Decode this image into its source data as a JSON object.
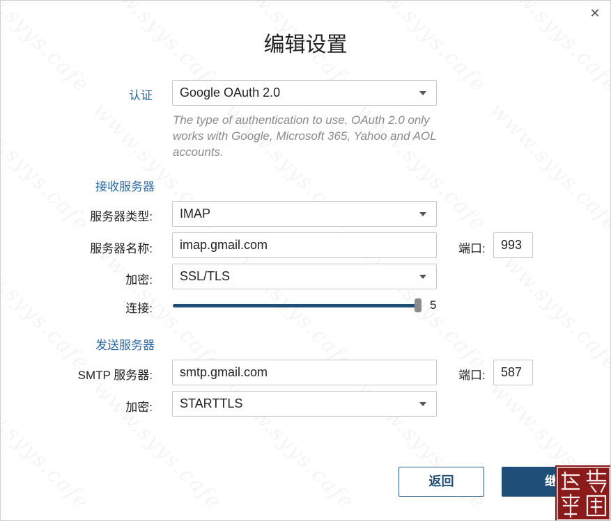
{
  "dialog": {
    "title": "编辑设置",
    "close_icon": "close-icon"
  },
  "auth": {
    "label": "认证",
    "value": "Google OAuth 2.0",
    "hint": "The type of authentication to use. OAuth 2.0 only works with Google, Microsoft 365, Yahoo and AOL accounts."
  },
  "incoming": {
    "section_title": "接收服务器",
    "server_type_label": "服务器类型:",
    "server_type_value": "IMAP",
    "server_name_label": "服务器名称:",
    "server_name_value": "imap.gmail.com",
    "port_label": "端口:",
    "port_value": "993",
    "encryption_label": "加密:",
    "encryption_value": "SSL/TLS",
    "connections_label": "连接:",
    "connections_value": "5",
    "connections_fraction": 1.0
  },
  "outgoing": {
    "section_title": "发送服务器",
    "smtp_label": "SMTP 服务器:",
    "smtp_value": "smtp.gmail.com",
    "port_label": "端口:",
    "port_value": "587",
    "encryption_label": "加密:",
    "encryption_value": "STARTTLS"
  },
  "buttons": {
    "back": "返回",
    "continue": "继续"
  },
  "watermark": {
    "text": "www.syys.cafe"
  },
  "colors": {
    "accent": "#1f4e79",
    "section": "#2b6aa6",
    "hint": "#8a8a8a",
    "seal": "#8b1a1a"
  }
}
